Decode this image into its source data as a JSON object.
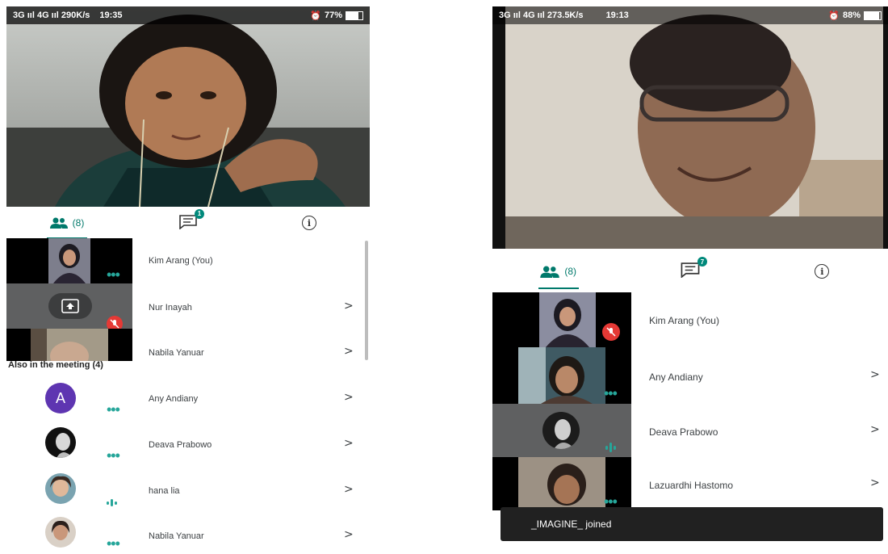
{
  "left": {
    "status": {
      "network": "3G ııl 4G ııl 290K/s",
      "time": "19:35",
      "battery": "77%",
      "battery_level": 0.77
    },
    "tabs": {
      "people_count": "(8)",
      "chat_badge": "1"
    },
    "participants": [
      {
        "name": "Kim Arang (You)"
      },
      {
        "name": "Nur Inayah"
      },
      {
        "name": "Nabila Yanuar"
      }
    ],
    "also_label": "Also in the meeting (4)",
    "also": [
      {
        "name": "Any Andiany",
        "initial": "A"
      },
      {
        "name": "Deava Prabowo"
      },
      {
        "name": "hana lia"
      },
      {
        "name": "Nabila Yanuar"
      }
    ],
    "chevron": ">"
  },
  "right": {
    "status": {
      "network": "3G ııl 4G ııl 273.5K/s",
      "time": "19:13",
      "battery": "88%",
      "battery_level": 0.88
    },
    "tabs": {
      "people_count": "(8)",
      "chat_badge": "7"
    },
    "participants": [
      {
        "name": "Kim Arang (You)"
      },
      {
        "name": "Any Andiany"
      },
      {
        "name": "Deava Prabowo"
      },
      {
        "name": "Lazuardhi Hastomo"
      }
    ],
    "toast": "_IMAGINE_ joined",
    "chevron": ">"
  },
  "colors": {
    "accent": "#00796b",
    "mic_off": "#e53935",
    "toast_bg": "#212121"
  }
}
